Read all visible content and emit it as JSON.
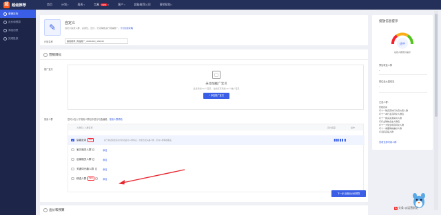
{
  "app": {
    "name": "超级推荐",
    "logo_char": "超"
  },
  "nav": [
    {
      "label": "首页",
      "active": false,
      "caret": false,
      "new": false
    },
    {
      "label": "计划",
      "active": false,
      "caret": true,
      "new": false
    },
    {
      "label": "报表",
      "active": false,
      "caret": true,
      "new": false
    },
    {
      "label": "工具",
      "active": true,
      "caret": true,
      "new": true
    },
    {
      "label": "客户",
      "active": false,
      "caret": true,
      "new": false
    },
    {
      "label": "超级推荐公司",
      "active": false,
      "caret": false,
      "new": false
    },
    {
      "label": "营销帮助",
      "active": false,
      "caret": true,
      "new": false
    }
  ],
  "new_tag": "NEW",
  "sidebar": [
    {
      "label": "营销目标",
      "active": true
    },
    {
      "label": "出价和预算",
      "active": false
    },
    {
      "label": "添加创意",
      "active": false
    },
    {
      "label": "完成投放",
      "active": false
    }
  ],
  "top_card": {
    "title": "自定义",
    "desc": "自定义投放人群、资源位、出价，灵活精准进行营销推广。",
    "desc_link": "计划创建攻略",
    "plan_name_label": "计划名称",
    "plan_name_value": "超级推荐_商品推广_20201110_161648"
  },
  "goal_section": {
    "title": "营销目标",
    "promo_label": "推广宝贝",
    "empty_title": "未添加推广宝贝",
    "empty_sub": "最多添加 30 个宝贝，当前还可添加 30 个推广宝贝",
    "add_button": "+ 添加推广宝贝",
    "audience_label": "常用人群",
    "audience_desc": "您可以在以下常用人群包中进行勾选编辑，",
    "audience_link": "常用人群帮助",
    "table_headers": {
      "name": "人群包 | 人群名称",
      "strength": "竞价强度",
      "op": "操作"
    },
    "rows": [
      {
        "name": "智能定向",
        "badge": "HOT",
        "desc": "基于算法模型自动分析商品与人群特点，智能匹配兴趣人群，定向人群精准覆盖",
        "selected": true,
        "control": "checkbox",
        "add": ""
      },
      {
        "name": "宝贝相关人群",
        "badge": "",
        "desc": "",
        "selected": false,
        "control": "radio",
        "add": "添加"
      },
      {
        "name": "店铺相关人群",
        "badge": "",
        "desc": "",
        "selected": false,
        "control": "radio",
        "add": "添加"
      },
      {
        "name": "关键词兴趣人群",
        "badge": "",
        "desc": "",
        "selected": false,
        "control": "radio",
        "add": "添加"
      },
      {
        "name": "精选人群",
        "badge": "NEW",
        "desc": "",
        "selected": false,
        "control": "radio",
        "add": "添加"
      }
    ],
    "next_button": "下一步,设置出价和预算"
  },
  "bottom_section": {
    "title": "出价和预算"
  },
  "right_panel": {
    "title": "投放信息提示",
    "gauge_label": "适中",
    "gauge_sub": "在线人群竞价提示",
    "fields": [
      {
        "label": "预估覆盖人群",
        "value": "-"
      },
      {
        "label": "预估最大展现量",
        "value": "-"
      }
    ],
    "selected_label": "已选人群：",
    "list": [
      "智能定向",
      "叮十一购买实时行为高价值人群",
      "叮十一本行业高转化人群包",
      "叮十一购买资源实时人群",
      "叮行业购物点击人群包",
      "叮十一大促全场高转化人群",
      "叮十一重要购物偏好人群",
      "叮活跃店铺人群"
    ],
    "link": "查看全部可用人群"
  },
  "watermark": "头条 @运营前沿"
}
